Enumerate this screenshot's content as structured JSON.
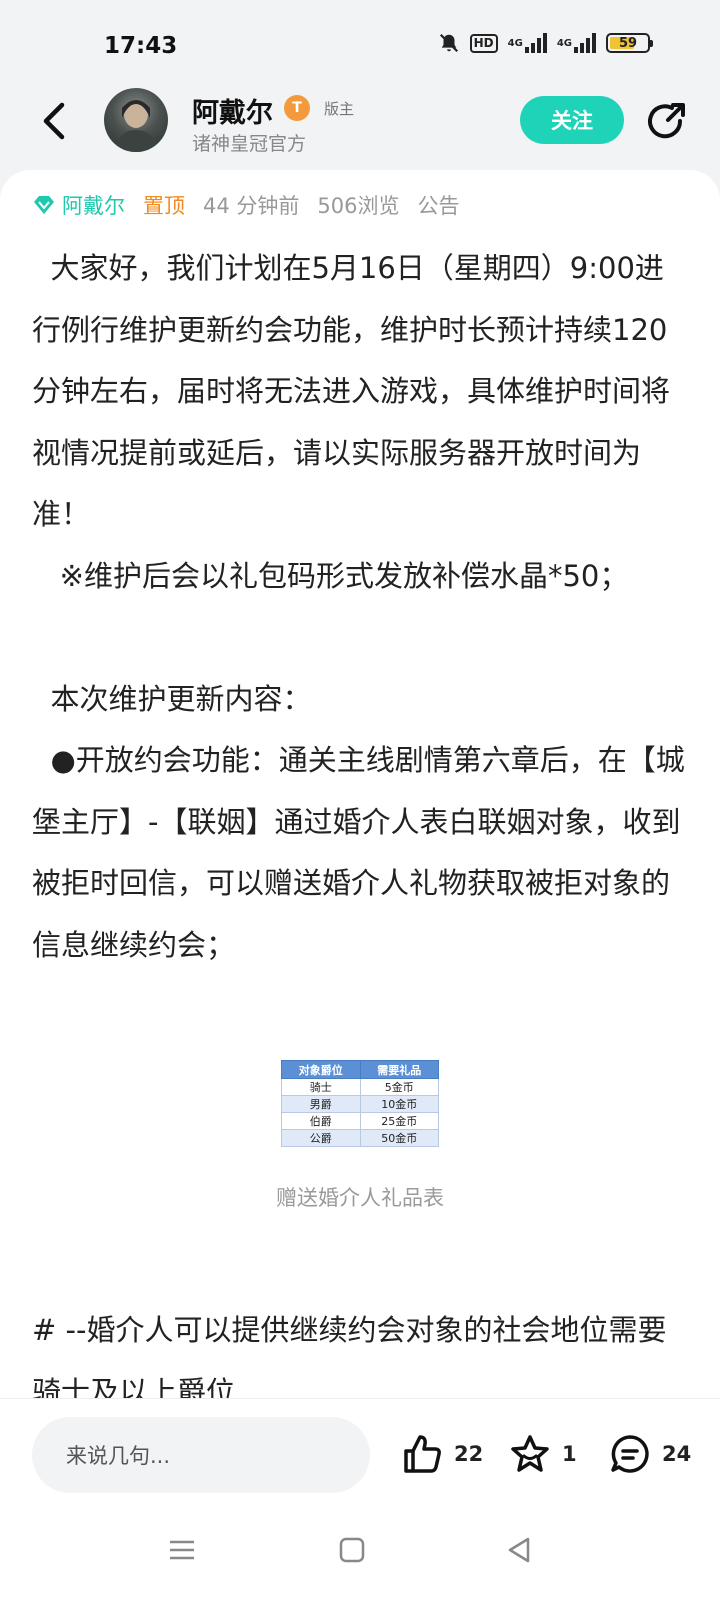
{
  "status_bar": {
    "time": "17:43",
    "network_hd": "HD",
    "signal_1": "4G",
    "signal_2": "4G",
    "battery": "59"
  },
  "header": {
    "author_name": "阿戴尔",
    "level_badge": "T",
    "role_tag": "版主",
    "subtitle": "诸神皇冠官方",
    "follow_label": "关注",
    "back_icon": "chevron-left-icon",
    "share_icon": "share-icon"
  },
  "post": {
    "meta": {
      "author": "阿戴尔",
      "pinned": "置顶",
      "time_ago": "44 分钟前",
      "views": "506浏览",
      "category": "公告"
    },
    "paragraphs": [
      "  大家好，我们计划在5月16日（星期四）9:00进行例行维护更新约会功能，维护时长预计持续120分钟左右，届时将无法进入游戏，具体维护时间将视情况提前或延后，请以实际服务器开放时间为准！",
      "   ※维护后会以礼包码形式发放补偿水晶*50；",
      " ",
      "  本次维护更新内容：",
      "  ●开放约会功能：通关主线剧情第六章后，在【城堡主厅】-【联姻】通过婚介人表白联姻对象，收到被拒时回信，可以赠送婚介人礼物获取被拒对象的信息继续约会；"
    ],
    "table": {
      "headers": [
        "对象爵位",
        "需要礼品"
      ],
      "rows": [
        [
          "骑士",
          "5金币"
        ],
        [
          "男爵",
          "10金币"
        ],
        [
          "伯爵",
          "25金币"
        ],
        [
          "公爵",
          "50金币"
        ]
      ]
    },
    "table_caption": "赠送婚介人礼品表",
    "tail_paragraph": "    # --婚介人可以提供继续约会对象的社会地位需要骑士及以上爵位"
  },
  "bottom_bar": {
    "comment_placeholder": "来说几句...",
    "likes": "22",
    "favorites": "1",
    "comments": "24"
  },
  "colors": {
    "accent": "#1fd3b8",
    "pinned": "#f28a22",
    "badge": "#f39a3d"
  }
}
